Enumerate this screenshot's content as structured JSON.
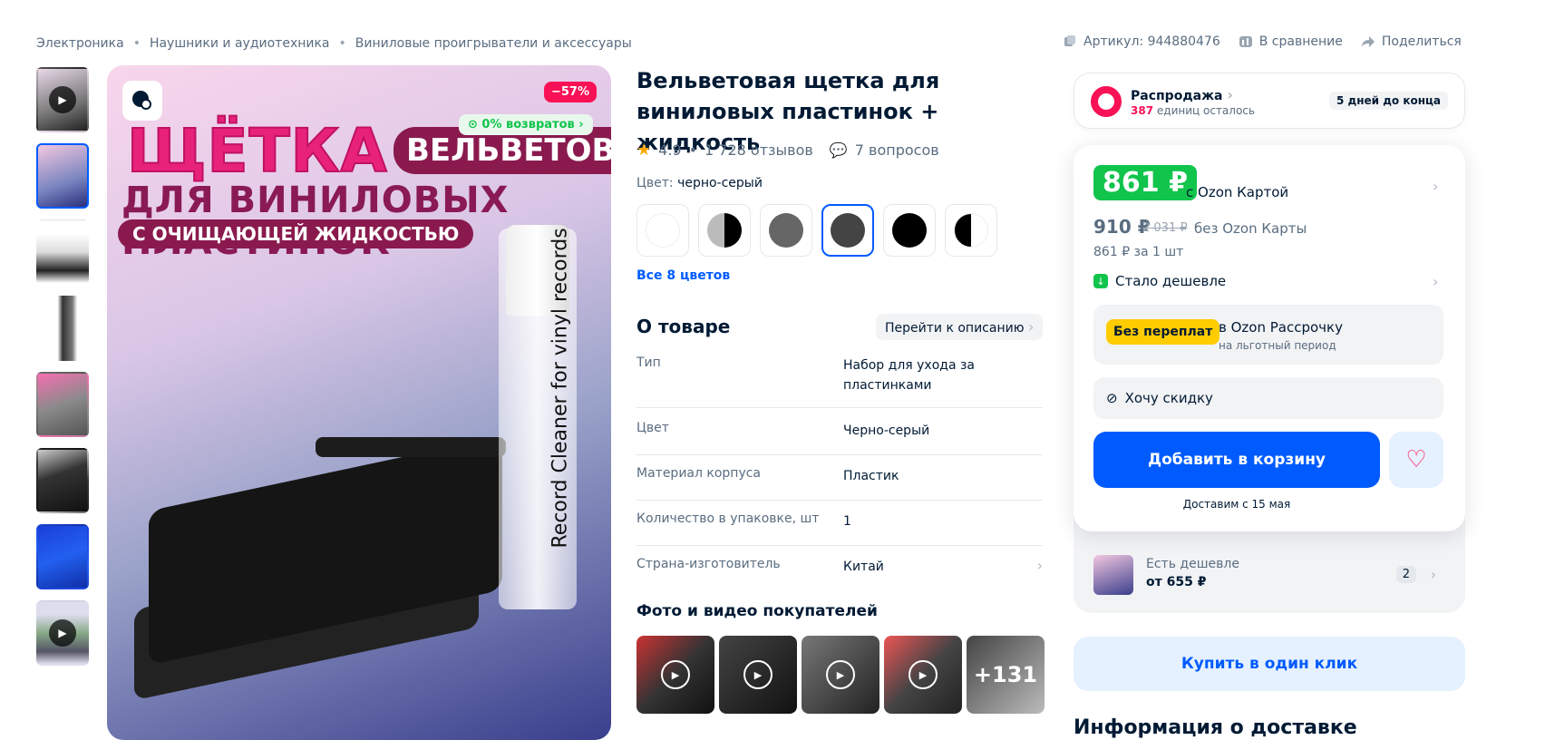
{
  "breadcrumbs": [
    "Электроника",
    "Наушники и аудиотехника",
    "Виниловые проигрыватели и аксессуары"
  ],
  "header_actions": {
    "article": "Артикул: 944880476",
    "compare": "В сравнение",
    "share": "Поделиться"
  },
  "hero": {
    "discount": "−57%",
    "returns": "0% возвратов",
    "headline_1": "ЩЁТКА",
    "headline_badge": "ВЕЛЬВЕТОВАЯ",
    "headline_2": "ДЛЯ ВИНИЛОВЫХ ПЛАСТИНОК",
    "headline_3": "С ОЧИЩАЮЩЕЙ ЖИДКОСТЬЮ",
    "bottle_text": "Record Cleaner for vinyl records"
  },
  "product": {
    "title": "Вельветовая щетка для виниловых пластинок + жидкость",
    "rating": "4.9",
    "reviews": "1 728 отзывов",
    "questions": "7 вопросов",
    "color_label": "Цвет:",
    "color_value": "черно-серый",
    "all_colors": "Все 8 цветов",
    "swatch_colors": [
      "#ffffff",
      "half-grey",
      "#666666",
      "#444444",
      "#000000",
      "half-black"
    ]
  },
  "about": {
    "title": "О товаре",
    "goto": "Перейти к описанию",
    "props": [
      {
        "k": "Тип",
        "v": "Набор для ухода за пластинками"
      },
      {
        "k": "Цвет",
        "v": "Черно-серый"
      },
      {
        "k": "Материал корпуса",
        "v": "Пластик"
      },
      {
        "k": "Количество в упаковке, шт",
        "v": "1"
      },
      {
        "k": "Страна-изготовитель",
        "v": "Китай"
      }
    ]
  },
  "photos": {
    "title": "Фото и видео покупателей",
    "more": "+131"
  },
  "sale": {
    "title": "Распродажа",
    "left_count": "387",
    "left_text": "единиц осталось",
    "days": "5 дней до конца"
  },
  "price": {
    "main": "861 ₽",
    "with_card": "с Ozon Картой",
    "old": "910 ₽",
    "strike": "2 031 ₽",
    "without_card": "без Ozon Карты",
    "unit": "861 ₽ за 1 шт",
    "cheaper": "Стало дешевле",
    "install_tag": "Без переплат",
    "install_a": "в Ozon Рассрочку",
    "install_b": "на льготный период",
    "want_discount": "Хочу скидку",
    "add_to_cart": "Добавить в корзину",
    "delivery": "Доставим с 15 мая",
    "cheaper_alt": "Есть дешевле",
    "cheaper_alt_price": "от 655 ₽",
    "cheaper_alt_count": "2",
    "one_click": "Купить в один клик"
  },
  "delivery_title": "Информация о доставке",
  "colors": {
    "accent": "#005bff",
    "green": "#10c44c",
    "pink": "#f91155"
  }
}
